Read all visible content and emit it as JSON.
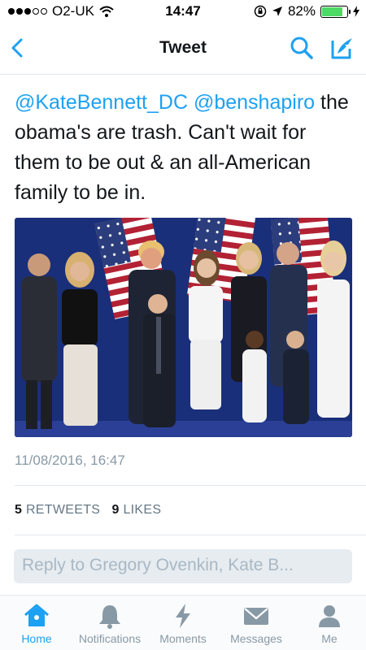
{
  "status_bar": {
    "carrier": "O2-UK",
    "time": "14:47",
    "battery": "82%",
    "battery_level": 0.82,
    "signal_bars_filled": 3,
    "signal_bars_total": 5
  },
  "nav": {
    "title": "Tweet",
    "back_icon": "chevron-left-icon",
    "search_icon": "search-icon",
    "compose_icon": "compose-icon"
  },
  "tweet": {
    "mention_1": "@KateBennett_DC",
    "mention_2": "@benshapiro",
    "body": "the obama's are trash. Can't wait for them to be out & an all-American family to be in.",
    "timestamp": "11/08/2016, 16:47",
    "retweets_count": "5",
    "retweets_label": "RETWEETS",
    "likes_count": "9",
    "likes_label": "LIKES"
  },
  "reply": {
    "placeholder": "Reply to Gregory Ovenkin, Kate B..."
  },
  "tabs": [
    {
      "label": "Home",
      "icon": "home-icon",
      "active": true
    },
    {
      "label": "Notifications",
      "icon": "bell-icon",
      "active": false
    },
    {
      "label": "Moments",
      "icon": "lightning-icon",
      "active": false
    },
    {
      "label": "Messages",
      "icon": "envelope-icon",
      "active": false
    },
    {
      "label": "Me",
      "icon": "person-icon",
      "active": false
    }
  ],
  "colors": {
    "accent": "#1da1f2",
    "text": "#14171a",
    "muted": "#8899a6",
    "battery": "#4cd964"
  }
}
